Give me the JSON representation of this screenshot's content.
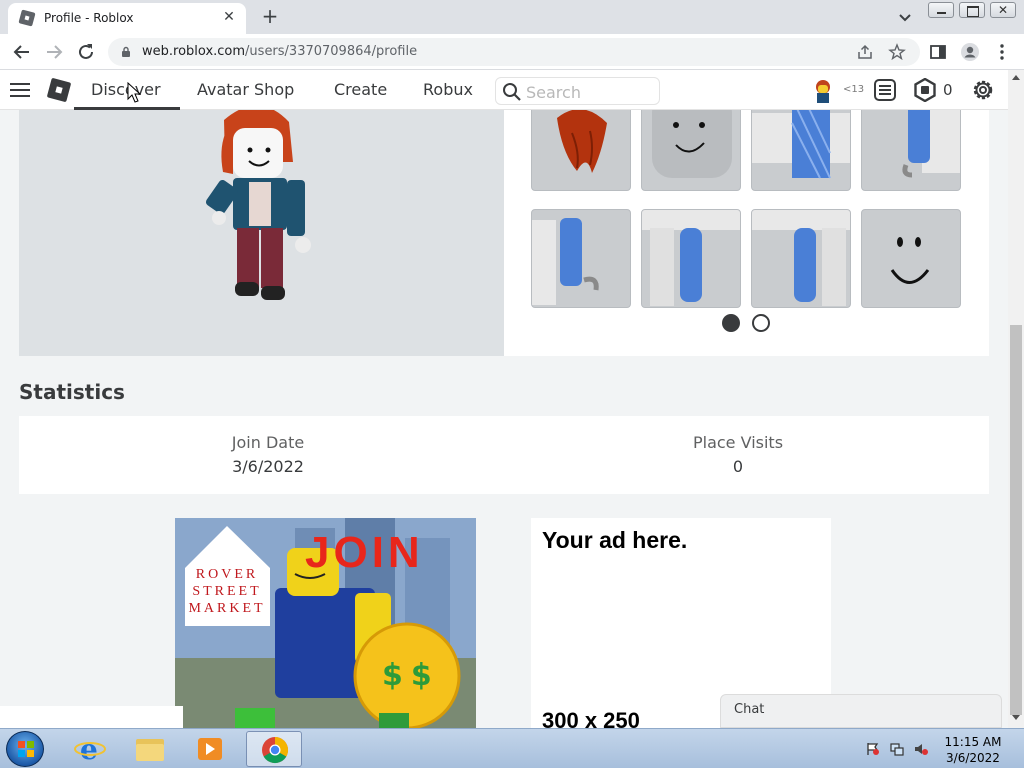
{
  "browser": {
    "tab_title": "Profile - Roblox",
    "url_host": "web.roblox.com",
    "url_path": "/users/3370709864/profile"
  },
  "header": {
    "nav": [
      "Discover",
      "Avatar Shop",
      "Create",
      "Robux"
    ],
    "search_placeholder": "Search",
    "age_label": "<13",
    "robux_count": "0"
  },
  "avatar": {
    "items": [
      {
        "icon": "hair-icon"
      },
      {
        "icon": "head-icon"
      },
      {
        "icon": "shirt-torso-icon"
      },
      {
        "icon": "right-arm-icon"
      },
      {
        "icon": "left-arm-icon"
      },
      {
        "icon": "left-leg-icon"
      },
      {
        "icon": "right-leg-icon"
      },
      {
        "icon": "face-icon"
      }
    ],
    "pages": 2,
    "current_page": 1
  },
  "statistics": {
    "title": "Statistics",
    "join_date_label": "Join Date",
    "join_date": "3/6/2022",
    "place_visits_label": "Place Visits",
    "place_visits": "0"
  },
  "ads": {
    "image_brand": "ROVER STREET MARKET",
    "image_headline": "JOIN",
    "headline": "Your ad here.",
    "size": "300 x 250"
  },
  "chat": {
    "label": "Chat"
  },
  "taskbar": {
    "time": "11:15 AM",
    "date": "3/6/2022"
  },
  "colors": {
    "roblox_text": "#393b3d",
    "chrome_tab_bg": "#dee1e6",
    "page_bg": "#f2f4f5"
  }
}
